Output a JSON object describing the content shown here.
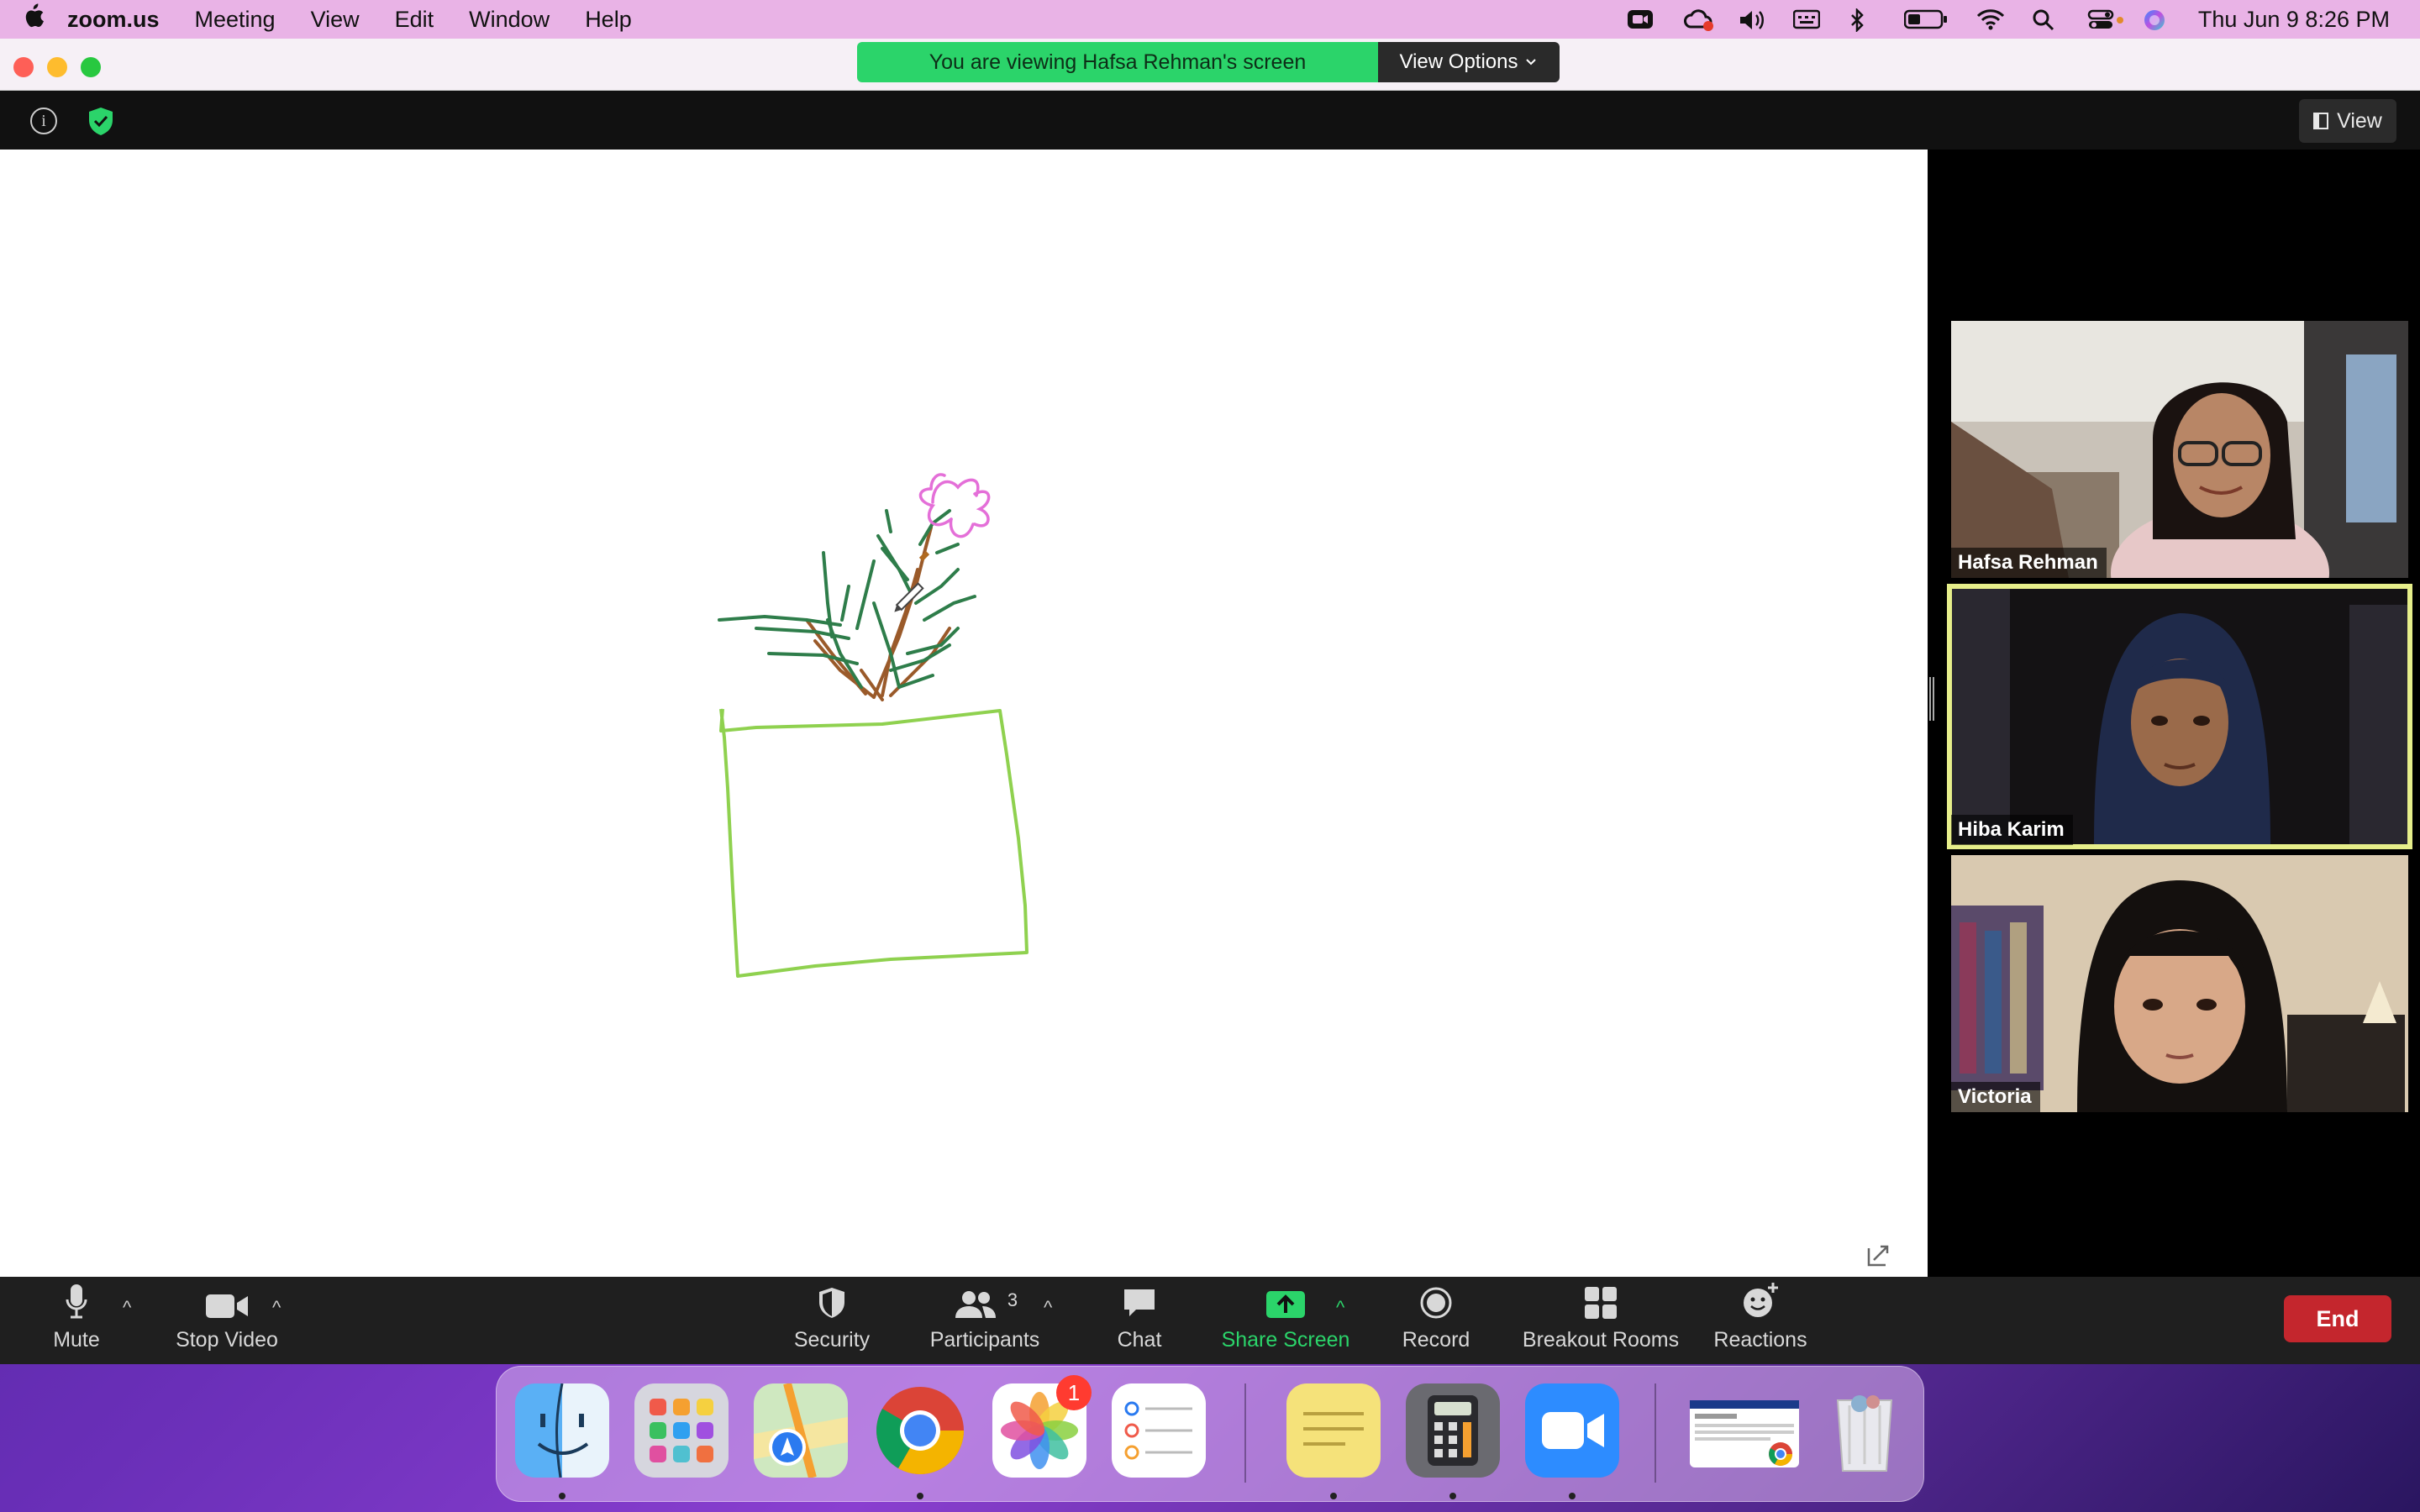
{
  "menubar": {
    "app_name": "zoom.us",
    "items": [
      "Meeting",
      "View",
      "Edit",
      "Window",
      "Help"
    ],
    "clock": "Thu Jun 9  8:26 PM",
    "status_icons": [
      "zoom-camera-icon",
      "creative-cloud-icon",
      "volume-icon",
      "keyboard-icon",
      "bluetooth-icon",
      "battery-icon",
      "wifi-icon",
      "spotlight-search-icon",
      "control-center-icon",
      "siri-icon"
    ]
  },
  "banner": {
    "viewing_text": "You are viewing Hafsa Rehman's screen",
    "view_options_label": "View Options"
  },
  "top": {
    "view_label": "View"
  },
  "participants": [
    {
      "name": "Hafsa Rehman"
    },
    {
      "name": "Hiba Karim",
      "active_speaker": true
    },
    {
      "name": "Victoria"
    }
  ],
  "toolbar": {
    "mute_label": "Mute",
    "stop_video_label": "Stop Video",
    "security_label": "Security",
    "participants_label": "Participants",
    "participants_count": "3",
    "chat_label": "Chat",
    "share_screen_label": "Share Screen",
    "record_label": "Record",
    "breakout_label": "Breakout Rooms",
    "reactions_label": "Reactions",
    "end_label": "End"
  },
  "colors": {
    "menubar_bg": "#e9b3e6",
    "banner_green": "#2bd46a",
    "end_red": "#c4262d",
    "active_speaker_border": "#e6ee8a",
    "pot_green": "#8fd14f",
    "leaf_green": "#2e7d4a",
    "stem_brown": "#9a5a2a",
    "flower_pink": "#e46fd8"
  },
  "dock": {
    "apps": [
      "Finder",
      "Launchpad",
      "Maps",
      "Google Chrome",
      "Photos",
      "Reminders",
      "Stickies",
      "Calculator",
      "zoom.us",
      "Chrome Window",
      "Trash"
    ],
    "photos_badge": "1"
  }
}
